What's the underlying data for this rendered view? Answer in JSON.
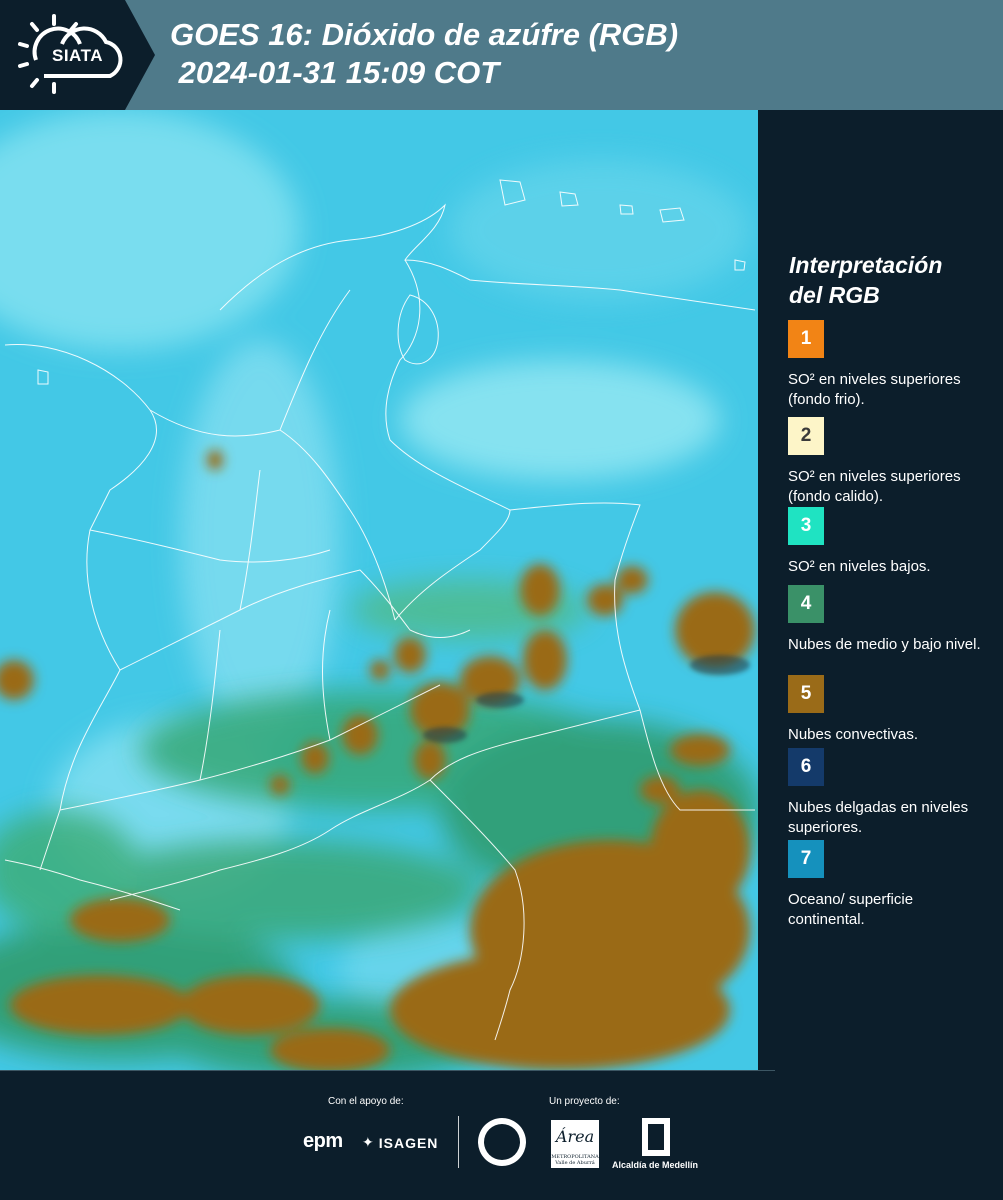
{
  "header": {
    "logo_text": "SIATA",
    "title_line1": "GOES 16: Dióxido de azúfre (RGB)",
    "title_line2": " 2024-01-31 15:09 COT",
    "background_color": "#4f7a8a"
  },
  "map": {
    "subject": "GOES 16 satellite RGB view of Colombia",
    "base_color": "#43c8e6"
  },
  "legend": {
    "title_line1": "Interpretación",
    "title_line2": "del RGB",
    "items": [
      {
        "number": "1",
        "label": "SO² en niveles superiores (fondo frio).",
        "color": "#f28415"
      },
      {
        "number": "2",
        "label": "SO² en niveles superiores (fondo calido).",
        "color": "#fdf5c8"
      },
      {
        "number": "3",
        "label": "SO² en niveles bajos.",
        "color": "#1fe3c2"
      },
      {
        "number": "4",
        "label": "Nubes de medio y bajo nivel.",
        "color": "#3a9168"
      },
      {
        "number": "5",
        "label": "Nubes convectivas.",
        "color": "#9a6b18"
      },
      {
        "number": "6",
        "label": "Nubes delgadas en niveles superiores.",
        "color": "#143a6a"
      },
      {
        "number": "7",
        "label": "Oceano/ superficie continental.",
        "color": "#1591bd"
      }
    ]
  },
  "footer": {
    "support_label": "Con el apoyo de:",
    "project_label": "Un proyecto de:",
    "sponsor_epm": "epm",
    "sponsor_isagen": "ISAGEN",
    "area_logo": "Área",
    "area_sub": "METROPOLITANA Valle de Aburrá",
    "alcaldia": "Alcaldía de Medellín"
  }
}
